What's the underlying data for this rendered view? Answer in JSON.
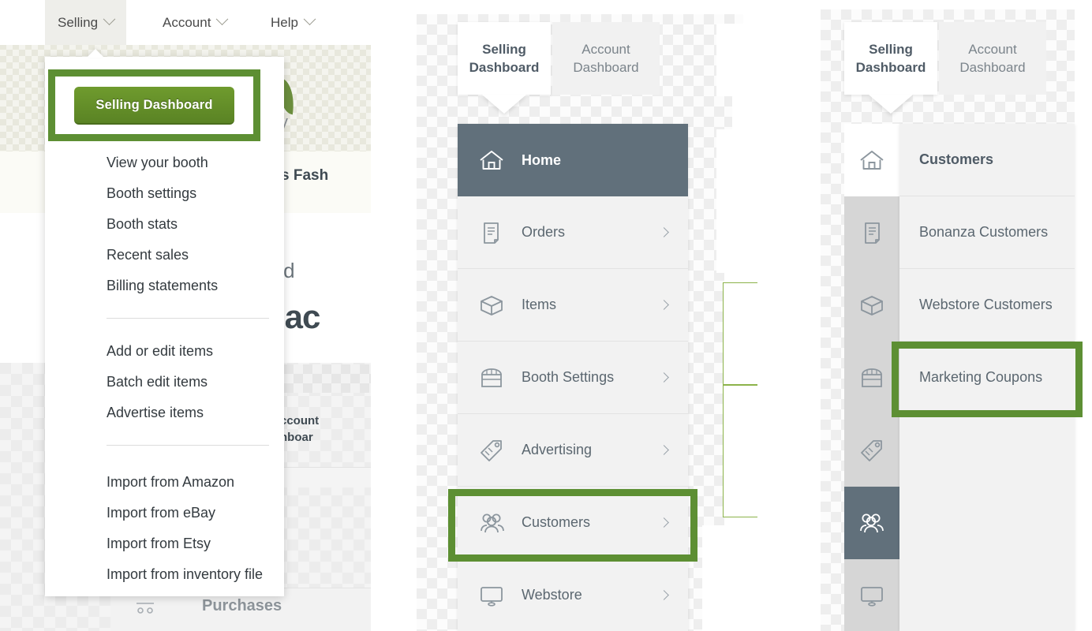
{
  "accent": {
    "highlight_green": "#5d8f33",
    "button_green": "#6f9b2e",
    "sidebar_active": "#61707b",
    "rail_grey": "#d6d6d6",
    "panel_grey": "#f2f2f2"
  },
  "panel1": {
    "topnav": [
      {
        "label": "Selling",
        "icon": "chevron-down-icon",
        "active": true
      },
      {
        "label": "Account",
        "icon": "chevron-down-icon",
        "active": false
      },
      {
        "label": "Help",
        "icon": "chevron-down-icon",
        "active": false
      }
    ],
    "dropdown": {
      "primary_button": "Selling Dashboard",
      "group1": [
        "View your booth",
        "Booth settings",
        "Booth stats",
        "Recent sales",
        "Billing statements"
      ],
      "group2": [
        "Add or edit items",
        "Batch edit items",
        "Advertise items"
      ],
      "group3": [
        "Import from Amazon",
        "Import from eBay",
        "Import from Etsy",
        "Import from inventory file"
      ]
    },
    "background_fragments": {
      "fash": "s Fash",
      "ard": "ard",
      "bac": "bac",
      "count": "ccount",
      "hboard": "hboar",
      "y": "y",
      "purchases": "Purchases"
    }
  },
  "panel2": {
    "tabs": [
      {
        "line1": "Selling",
        "line2": "Dashboard",
        "active": true
      },
      {
        "line1": "Account",
        "line2": "Dashboard",
        "active": false
      }
    ],
    "sidebar": [
      {
        "label": "Home",
        "icon": "home-icon",
        "chevron": false,
        "active": true
      },
      {
        "label": "Orders",
        "icon": "orders-icon",
        "chevron": true,
        "active": false
      },
      {
        "label": "Items",
        "icon": "items-box-icon",
        "chevron": true,
        "active": false
      },
      {
        "label": "Booth Settings",
        "icon": "storefront-icon",
        "chevron": true,
        "active": false
      },
      {
        "label": "Advertising",
        "icon": "price-tag-icon",
        "chevron": true,
        "active": false
      },
      {
        "label": "Customers",
        "icon": "people-group-icon",
        "chevron": true,
        "active": false,
        "highlighted": true
      },
      {
        "label": "Webstore",
        "icon": "monitor-icon",
        "chevron": true,
        "active": false
      }
    ]
  },
  "panel3": {
    "tabs": [
      {
        "line1": "Selling",
        "line2": "Dashboard",
        "active": true
      },
      {
        "line1": "Account",
        "line2": "Dashboard",
        "active": false
      }
    ],
    "rail": [
      {
        "icon": "home-icon",
        "state": "white"
      },
      {
        "icon": "orders-icon",
        "state": "grey"
      },
      {
        "icon": "items-box-icon",
        "state": "grey"
      },
      {
        "icon": "storefront-icon",
        "state": "grey"
      },
      {
        "icon": "price-tag-icon",
        "state": "grey"
      },
      {
        "icon": "people-group-icon",
        "state": "selected"
      },
      {
        "icon": "monitor-icon",
        "state": "grey"
      }
    ],
    "submenu": {
      "heading": "Customers",
      "items": [
        {
          "label": "Bonanza Customers",
          "highlighted": false
        },
        {
          "label": "Webstore Customers",
          "highlighted": false
        },
        {
          "label": "Marketing Coupons",
          "highlighted": true
        }
      ]
    }
  }
}
